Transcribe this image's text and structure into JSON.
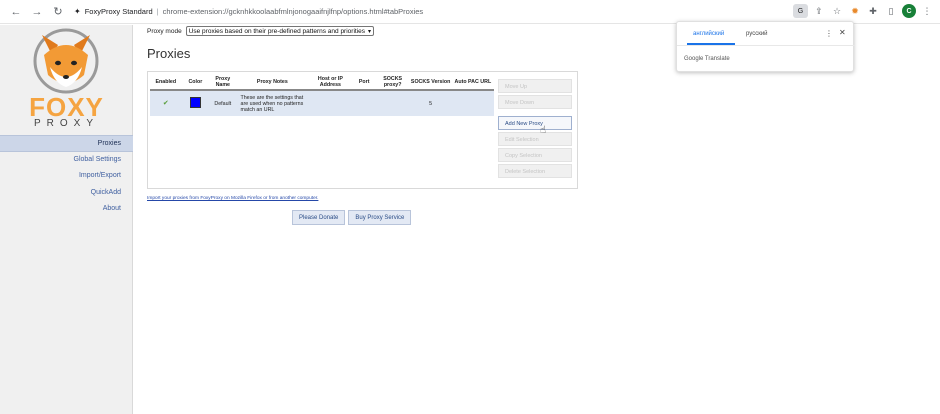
{
  "browser": {
    "page_title": "FoxyProxy Standard",
    "url": "chrome-extension://gcknhkkoolaabfmlnjonogaaifnjlfnp/options.html#tabProxies",
    "translate_badge": "G"
  },
  "sidebar": {
    "logo_word": "FOXY",
    "logo_sub": "PROXY",
    "items": [
      {
        "label": "Proxies",
        "active": true
      },
      {
        "label": "Global Settings"
      },
      {
        "label": "Import/Export"
      },
      {
        "label": "QuickAdd"
      },
      {
        "label": "About"
      }
    ]
  },
  "main": {
    "mode_label": "Proxy mode",
    "mode_value": "Use proxies based on their pre-defined patterns and priorities",
    "title": "Proxies",
    "table": {
      "columns": [
        "Enabled",
        "Color",
        "Proxy Name",
        "Proxy Notes",
        "Host or IP Address",
        "Port",
        "SOCKS proxy?",
        "SOCKS Version",
        "Auto PAC URL"
      ],
      "rows": [
        {
          "enabled_icon": "check-icon",
          "color": "#0000ff",
          "name": "Default",
          "notes": "These are the settings that are used when no patterns match an URL",
          "host": "",
          "port": "",
          "socks": "",
          "socks_version": "5",
          "pac_url": ""
        }
      ]
    },
    "buttons": {
      "move_up": "Move Up",
      "move_down": "Move Down",
      "add_new": "Add New Proxy",
      "edit": "Edit Selection",
      "copy": "Copy Selection",
      "delete": "Delete Selection"
    },
    "import_link": "Import your proxies from FoxyProxy on Mozilla Firefox or from another computer.",
    "donate": "Please Donate",
    "buy": "Buy Proxy Service"
  },
  "translate_popup": {
    "tab_source": "английский",
    "tab_target": "русский",
    "brand": "Google Translate"
  },
  "colors": {
    "sidebar_bg": "#f0f0f0",
    "active_item_bg": "#ccd6e8",
    "row_bg": "#dfe7f3",
    "accent_blue": "#1a73e8",
    "logo_orange": "#f5a441"
  }
}
